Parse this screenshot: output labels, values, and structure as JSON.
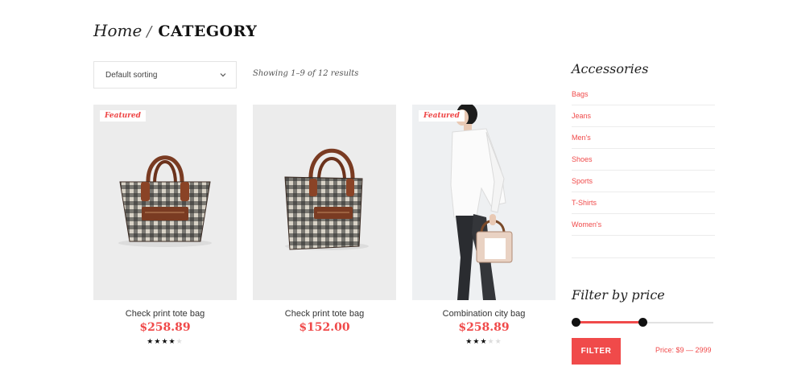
{
  "breadcrumb": {
    "home": "Home",
    "separator": "/",
    "current": "CATEGORY"
  },
  "sort": {
    "selected": "Default sorting"
  },
  "results": {
    "text": "Showing 1–9 of 12 results"
  },
  "products": [
    {
      "name": "Check print tote bag",
      "price": "$258.89",
      "featured": true,
      "badge": "Featured",
      "rating": 4,
      "rating_max": 5
    },
    {
      "name": "Check print tote bag",
      "price": "$152.00",
      "featured": false,
      "badge": "",
      "rating": 0,
      "rating_max": 5
    },
    {
      "name": "Combination city bag",
      "price": "$258.89",
      "featured": true,
      "badge": "Featured",
      "rating": 3,
      "rating_max": 5
    }
  ],
  "sidebar": {
    "categories_title": "Accessories",
    "categories": [
      {
        "label": "Bags"
      },
      {
        "label": "Jeans"
      },
      {
        "label": "Men's"
      },
      {
        "label": "Shoes"
      },
      {
        "label": "Sports"
      },
      {
        "label": "T-Shirts"
      },
      {
        "label": "Women's"
      }
    ],
    "filter_title": "Filter by price",
    "filter_button": "FILTER",
    "price_label": "Price: $9 — 2999",
    "price_range": {
      "min": 9,
      "max": 2999
    },
    "slider_selection": {
      "from": 0,
      "to": 0.5
    }
  },
  "colors": {
    "accent": "#f04a4a",
    "text": "#333333",
    "border": "#ececec",
    "handle": "#111111"
  }
}
